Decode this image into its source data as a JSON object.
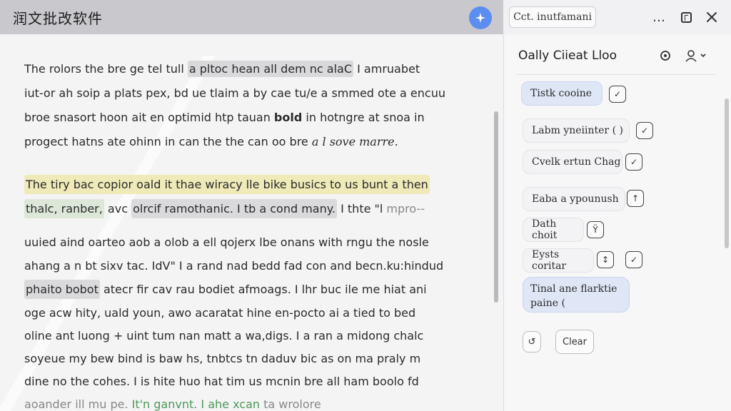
{
  "titlebar": {
    "app_title": "润文批改软件"
  },
  "toolbar": {
    "instructions_label": "Cct. inutfamani",
    "more_icon": "…"
  },
  "editor": {
    "paragraph1": [
      {
        "pre": "The rolors the bre ge tel tull ",
        "hl": "a pltoc hean all dem nc alaC",
        "post": " I amruabet"
      },
      {
        "pre": "iut-or ah soip a plats pex, bd ue tlaim a by cae tu/e a smmed ote a encuu",
        "hl": "",
        "post": ""
      },
      {
        "pre": "broe snasort hoon ait en optimid htp tauan ",
        "hl": "bold",
        "post": " in hotngre at snoa in"
      },
      {
        "pre": "progect hatns ate ohinn in can the the can oo bre ",
        "hl": "a l sove marre.",
        "post": ""
      }
    ],
    "paragraph2": {
      "line1": "The tiry bac copior oald it thae wiracy lle bike busics to us bunt a then",
      "line2_green": "thalc, ranber,",
      "line2_mid": " avc ",
      "line2_gray": "olrcif ramothanic. I tb a cond many.",
      "line2_end": " I thte \"l ",
      "line2_faded": "mpro--"
    },
    "paragraph3": [
      "uuied aind oarteo aob a olob a ell qojerx lbe onans with rngu the nosle",
      "ahang a n bt sixv tac. IdV\" I a rand nad bedd fad con and becn.ku:hindud",
      "",
      "oge acw hity, uald youn, awo acaratat hine en-pocto ai a tied to bed",
      "oline ant luong + uint tum nan matt a wa,digs. I a ran a midong chalc",
      "soyeue my bew bind is baw hs, tnbtcs tn daduv bic as on ma praly m",
      "dine no the cohes. I is hite huo hat tim us mcnin bre all ham boolo fd",
      ""
    ],
    "line3_hl": "phaito bobot",
    "line3_rest": " atecr fir cav rau bodiet afmoags. I lhr buc ile me hiat ani",
    "last_pre": "aoander ill mu pe.",
    "last_green": "It'n ganvnt. I ahe xcan",
    "last_end": " ta wrolore"
  },
  "panel": {
    "title": "Oally Ciieat Lloo",
    "chips": [
      {
        "label": "Tistk cooine",
        "icon": "✓"
      },
      {
        "label": "Labm yneiinter ( )",
        "icon": "✓"
      },
      {
        "label": "Cvelk ertun Chag",
        "icon": "✓"
      },
      {
        "label": "Eaba a ypounush",
        "icon": "↑"
      },
      {
        "label": "Dath choit",
        "icon": "Ϋ"
      },
      {
        "label": "Eysts coritar",
        "icon": "↕"
      }
    ],
    "eysts_extra_icon": "✓",
    "multiline_chip": "Tinal ane flarktie paine (",
    "clear_label": "Clear",
    "undo_icon": "↺"
  }
}
